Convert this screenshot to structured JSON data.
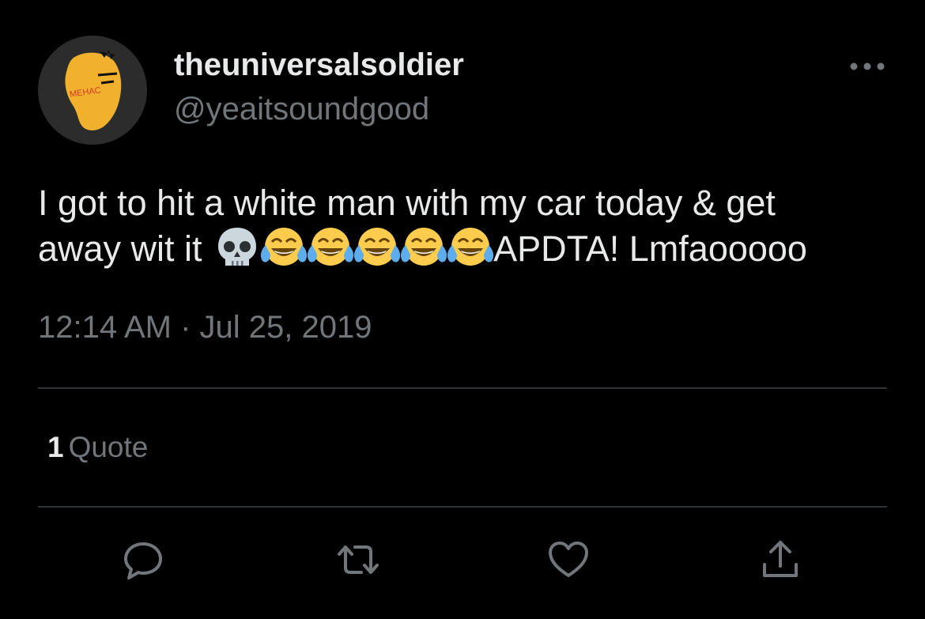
{
  "user": {
    "display_name": "theuniversalsoldier",
    "handle": "@yeaitsoundgood",
    "avatar_icon": "orange-face-avatar",
    "avatar_text": "MEHAC"
  },
  "more_icon": "more-horizontal-icon",
  "tweet": {
    "line1": "I got to hit a white man with my car today & get",
    "line2_before": "away wit it",
    "emojis": [
      "skull",
      "face-with-tears-of-joy",
      "face-with-tears-of-joy",
      "face-with-tears-of-joy",
      "face-with-tears-of-joy",
      "face-with-tears-of-joy"
    ],
    "line2_after": "APDTA! Lmfaooooo",
    "timestamp": "12:14 AM · Jul 25, 2019"
  },
  "stats": {
    "quote_count": "1",
    "quote_label": "Quote"
  },
  "actions": [
    {
      "name": "reply",
      "icon": "reply-icon"
    },
    {
      "name": "retweet",
      "icon": "retweet-icon"
    },
    {
      "name": "like",
      "icon": "heart-icon"
    },
    {
      "name": "share",
      "icon": "share-icon"
    }
  ],
  "colors": {
    "background": "#000000",
    "primary_text": "#e7e9ea",
    "secondary_text": "#71767b",
    "divider": "#2f3336"
  }
}
